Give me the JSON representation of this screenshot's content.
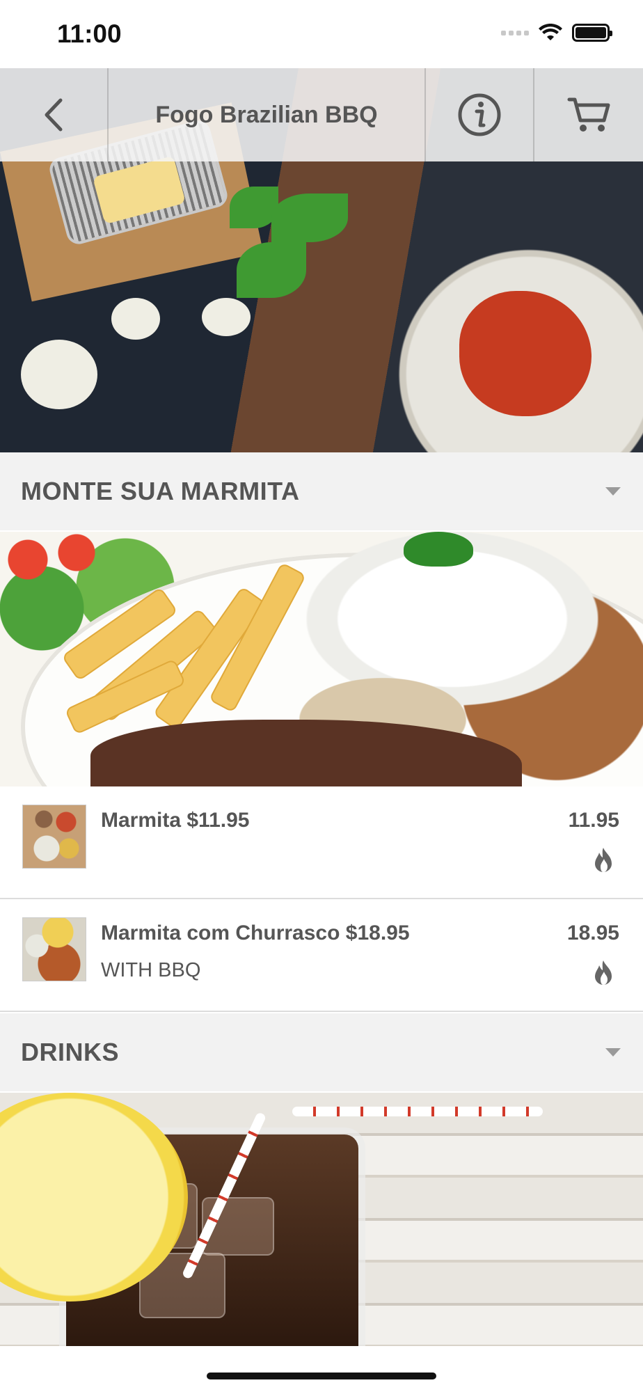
{
  "status_bar": {
    "time": "11:00"
  },
  "header": {
    "title": "Fogo Brazilian BBQ"
  },
  "categories": [
    {
      "title": "MONTE SUA MARMITA",
      "items": [
        {
          "name": "Marmita $11.95",
          "description": "",
          "price": "11.95"
        },
        {
          "name": "Marmita com Churrasco $18.95",
          "description": "WITH BBQ",
          "price": "18.95"
        }
      ]
    },
    {
      "title": "DRINKS",
      "items": []
    }
  ],
  "icons": {
    "back": "chevron-left-icon",
    "info": "info-icon",
    "cart": "cart-icon",
    "fire": "fire-icon",
    "caret": "caret-down-icon"
  },
  "colors": {
    "text": "#555555",
    "category_bg": "#f2f2f2",
    "header_overlay": "#f5f5f5"
  }
}
